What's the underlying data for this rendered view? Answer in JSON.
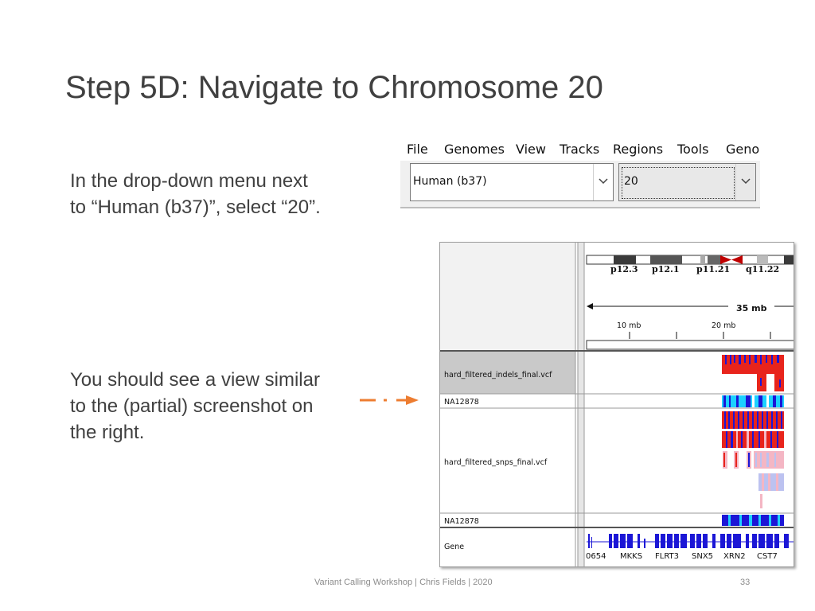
{
  "slide": {
    "title": "Step 5D: Navigate to Chromosome 20",
    "paragraph1": [
      "In the drop-down menu next",
      "to “Human (b37)”, select “20”."
    ],
    "paragraph2": [
      "You should see a view similar",
      "to the (partial) screenshot on",
      "the right."
    ],
    "footer": "Variant Calling Workshop | Chris Fields | 2020",
    "slide_number": "33"
  },
  "igv_menu": {
    "menu_items": [
      "File",
      "Genomes",
      "View",
      "Tracks",
      "Regions",
      "Tools",
      "Geno"
    ],
    "genome_value": "Human (b37)",
    "chromosome_value": "20"
  },
  "igv_view": {
    "cytobands": [
      "p12.3",
      "p12.1",
      "p11.21",
      "q11.22"
    ],
    "ruler_span": "35 mb",
    "ruler_ticks": [
      "10 mb",
      "20 mb"
    ],
    "tracks": {
      "indels_file": "hard_filtered_indels_final.vcf",
      "indels_sample": "NA12878",
      "snps_file": "hard_filtered_snps_final.vcf",
      "snps_sample": "NA12878",
      "gene_track": "Gene"
    },
    "genes": [
      "0654",
      "MKKS",
      "FLRT3",
      "SNX5",
      "XRN2",
      "CST7"
    ],
    "colors": {
      "variant_red": "#e8241c",
      "variant_blue": "#1b16d6",
      "sample_cyan": "#1cd1ff",
      "snp_pink": "#f4b6c4",
      "snp_lavender": "#bcc2f0",
      "arrow": "#ed7d31"
    }
  }
}
